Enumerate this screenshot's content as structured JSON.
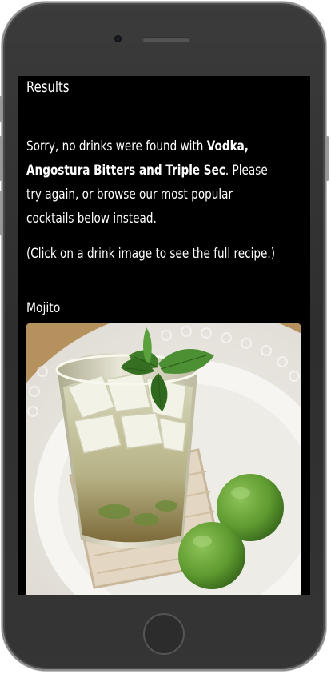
{
  "page": {
    "heading": "Results",
    "message": {
      "line1_pre": "Sorry, no drinks were found with ",
      "line1_bold": "Vodka,",
      "line2_bold": "Angostura Bitters and Triple Sec",
      "line2_post": ". Please",
      "line3": "try again, or browse our most popular",
      "line4": "cocktails below instead."
    },
    "hint": "(Click on a drink image to see the full recipe.)"
  },
  "drinks": [
    {
      "name": "Mojito",
      "image_alt": "Mojito"
    }
  ],
  "colors": {
    "screen_background": "#000000",
    "text": "#ffffff",
    "device_body": "#333333"
  }
}
